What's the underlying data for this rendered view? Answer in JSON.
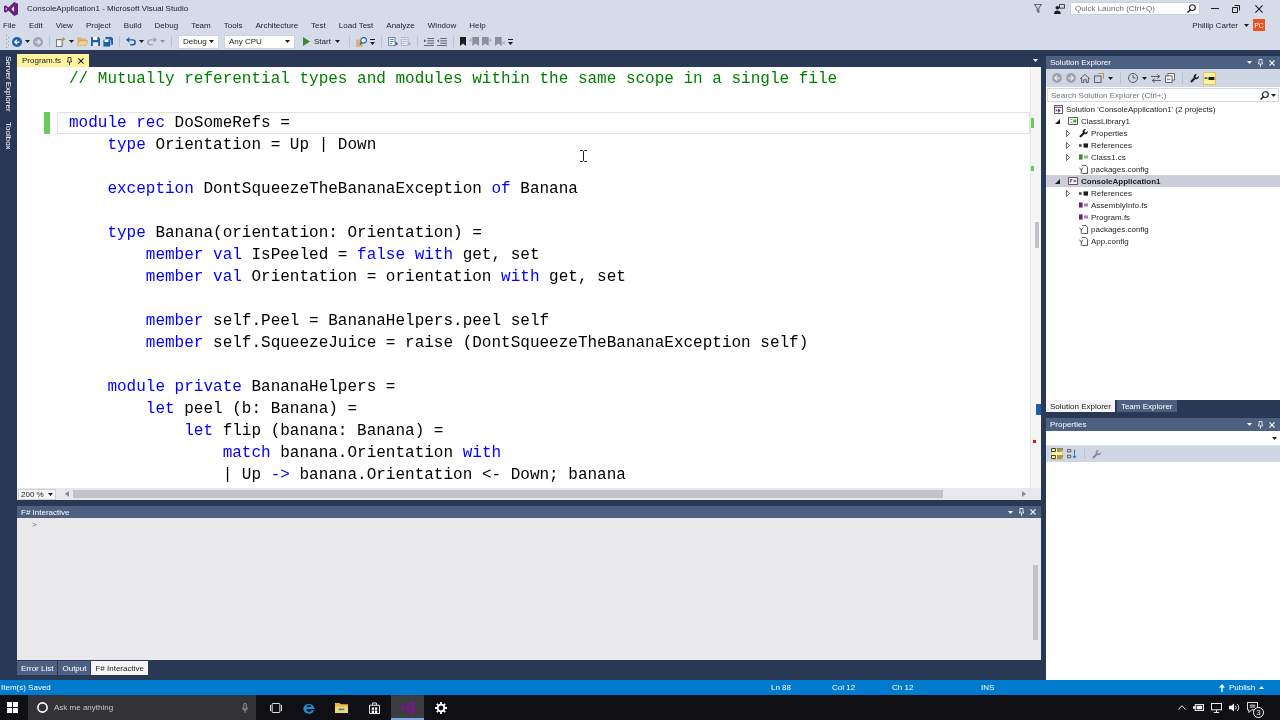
{
  "window": {
    "title": "ConsoleApplication1 - Microsoft Visual Studio",
    "quick_launch": {
      "placeholder": "Quick Launch (Ctrl+Q)"
    },
    "user": "Phillip Carter",
    "avatar": "PC"
  },
  "menu": [
    "File",
    "Edit",
    "View",
    "Project",
    "Build",
    "Debug",
    "Team",
    "Tools",
    "Architecture",
    "Test",
    "Load Test",
    "Analyze",
    "Window",
    "Help"
  ],
  "toolbar": [
    {
      "kind": "grip"
    },
    {
      "kind": "back",
      "disabled": false
    },
    {
      "kind": "caret",
      "disabled": false
    },
    {
      "kind": "forward",
      "disabled": true
    },
    {
      "kind": "separator"
    },
    {
      "kind": "new-project",
      "disabled": false
    },
    {
      "kind": "caret",
      "disabled": false
    },
    {
      "kind": "open",
      "disabled": false
    },
    {
      "kind": "save",
      "disabled": false
    },
    {
      "kind": "save-all",
      "disabled": false
    },
    {
      "kind": "separator"
    },
    {
      "kind": "undo",
      "disabled": false
    },
    {
      "kind": "caret",
      "disabled": false
    },
    {
      "kind": "redo",
      "disabled": true
    },
    {
      "kind": "caret",
      "disabled": true
    },
    {
      "kind": "separator"
    },
    {
      "kind": "combo",
      "value": "Debug"
    },
    {
      "kind": "combo",
      "value": "Any CPU"
    },
    {
      "kind": "start",
      "label": "Start"
    },
    {
      "kind": "separator"
    },
    {
      "kind": "find",
      "disabled": false
    },
    {
      "kind": "overflow"
    },
    {
      "kind": "separator"
    },
    {
      "kind": "member-list",
      "disabled": false
    },
    {
      "kind": "quick-info",
      "disabled": true
    },
    {
      "kind": "separator"
    },
    {
      "kind": "indent",
      "disabled": false
    },
    {
      "kind": "outdent",
      "disabled": false
    },
    {
      "kind": "separator"
    },
    {
      "kind": "bookmark",
      "disabled": false
    },
    {
      "kind": "bookmark-prev",
      "disabled": true
    },
    {
      "kind": "bookmark-next",
      "disabled": true
    },
    {
      "kind": "bookmark-clear",
      "disabled": true
    },
    {
      "kind": "overflow"
    }
  ],
  "side_tabs": [
    "Server Explorer",
    "Toolbox"
  ],
  "document_tabs": [
    {
      "label": "Program.fs",
      "selected": true
    }
  ],
  "editor": {
    "lines": [
      {
        "kind": "line",
        "tokens": [
          {
            "kind": "comment",
            "text": "// Mutually referential types and modules within the same scope in a single file"
          }
        ],
        "current": false,
        "changed": false
      },
      {
        "kind": "blank"
      },
      {
        "kind": "line",
        "tokens": [
          {
            "kind": "keyword",
            "text": "module rec"
          },
          {
            "kind": "plain",
            "text": " DoSomeRefs ="
          }
        ],
        "current": true,
        "changed": true,
        "children": [
          {
            "kind": "line",
            "tokens": [
              {
                "kind": "keyword",
                "text": "type"
              },
              {
                "kind": "plain",
                "text": " Orientation = Up | Down"
              }
            ],
            "current": false,
            "changed": false
          },
          {
            "kind": "blank"
          },
          {
            "kind": "line",
            "tokens": [
              {
                "kind": "keyword",
                "text": "exception"
              },
              {
                "kind": "plain",
                "text": " DontSqueezeTheBananaException "
              },
              {
                "kind": "keyword",
                "text": "of"
              },
              {
                "kind": "plain",
                "text": " Banana"
              }
            ],
            "current": false,
            "changed": false
          },
          {
            "kind": "blank"
          },
          {
            "kind": "line",
            "tokens": [
              {
                "kind": "keyword",
                "text": "type"
              },
              {
                "kind": "plain",
                "text": " Banana(orientation: Orientation) ="
              }
            ],
            "current": false,
            "changed": false,
            "children": [
              {
                "kind": "line",
                "tokens": [
                  {
                    "kind": "keyword",
                    "text": "member val"
                  },
                  {
                    "kind": "plain",
                    "text": " IsPeeled = "
                  },
                  {
                    "kind": "keyword",
                    "text": "false with"
                  },
                  {
                    "kind": "plain",
                    "text": " get, set"
                  }
                ],
                "current": false,
                "changed": false
              },
              {
                "kind": "line",
                "tokens": [
                  {
                    "kind": "keyword",
                    "text": "member val"
                  },
                  {
                    "kind": "plain",
                    "text": " Orientation = orientation "
                  },
                  {
                    "kind": "keyword",
                    "text": "with"
                  },
                  {
                    "kind": "plain",
                    "text": " get, set"
                  }
                ],
                "current": false,
                "changed": false
              },
              {
                "kind": "blank"
              },
              {
                "kind": "line",
                "tokens": [
                  {
                    "kind": "keyword",
                    "text": "member"
                  },
                  {
                    "kind": "plain",
                    "text": " self.Peel = BananaHelpers.peel self"
                  }
                ],
                "current": false,
                "changed": false
              },
              {
                "kind": "line",
                "tokens": [
                  {
                    "kind": "keyword",
                    "text": "member"
                  },
                  {
                    "kind": "plain",
                    "text": " self.SqueezeJuice = raise (DontSqueezeTheBananaException self)"
                  }
                ],
                "current": false,
                "changed": false
              }
            ]
          },
          {
            "kind": "blank"
          },
          {
            "kind": "line",
            "tokens": [
              {
                "kind": "keyword",
                "text": "module private"
              },
              {
                "kind": "plain",
                "text": " BananaHelpers ="
              }
            ],
            "current": false,
            "changed": false,
            "children": [
              {
                "kind": "line",
                "tokens": [
                  {
                    "kind": "keyword",
                    "text": "let"
                  },
                  {
                    "kind": "plain",
                    "text": " peel (b: Banana) ="
                  }
                ],
                "current": false,
                "changed": false,
                "children": [
                  {
                    "kind": "line",
                    "tokens": [
                      {
                        "kind": "keyword",
                        "text": "let"
                      },
                      {
                        "kind": "plain",
                        "text": " flip (banana: Banana) ="
                      }
                    ],
                    "current": false,
                    "changed": false,
                    "children": [
                      {
                        "kind": "line",
                        "tokens": [
                          {
                            "kind": "keyword",
                            "text": "match"
                          },
                          {
                            "kind": "plain",
                            "text": " banana.Orientation "
                          },
                          {
                            "kind": "keyword",
                            "text": "with"
                          }
                        ],
                        "current": false,
                        "changed": false
                      },
                      {
                        "kind": "line",
                        "tokens": [
                          {
                            "kind": "plain",
                            "text": "| Up "
                          },
                          {
                            "kind": "keyword",
                            "text": "->"
                          },
                          {
                            "kind": "plain",
                            "text": " banana.Orientation <- Down; banana"
                          }
                        ],
                        "current": false,
                        "changed": false
                      }
                    ]
                  }
                ]
              }
            ]
          }
        ]
      }
    ],
    "zoom": "200 %"
  },
  "fsharp_interactive": {
    "title": "F# Interactive",
    "prompt": ">"
  },
  "bottom_tabs": [
    {
      "label": "Error List",
      "selected": false
    },
    {
      "label": "Output",
      "selected": false
    },
    {
      "label": "F# Interactive",
      "selected": true
    }
  ],
  "solution_explorer": {
    "title": "Solution Explorer",
    "toolbar": [
      {
        "kind": "back",
        "disabled": true,
        "on": false
      },
      {
        "kind": "forward",
        "disabled": true,
        "on": false
      },
      {
        "kind": "home",
        "disabled": false,
        "on": false
      },
      {
        "kind": "switch-views",
        "disabled": false,
        "on": false
      },
      {
        "kind": "caret",
        "disabled": false,
        "on": false
      },
      {
        "kind": "separator"
      },
      {
        "kind": "pending-changes",
        "disabled": false,
        "on": false
      },
      {
        "kind": "caret",
        "disabled": false,
        "on": false
      },
      {
        "kind": "sync",
        "disabled": false,
        "on": false
      },
      {
        "kind": "collapse-all",
        "disabled": false,
        "on": false
      },
      {
        "kind": "separator"
      },
      {
        "kind": "properties",
        "disabled": false,
        "on": false
      },
      {
        "kind": "preview",
        "disabled": false,
        "on": true
      }
    ],
    "search": {
      "placeholder": "Search Solution Explorer (Ctrl+;)"
    },
    "tree": [
      {
        "label": "Solution 'ConsoleApplication1' (2 projects)",
        "kind": "solution",
        "selected": false,
        "startup": false,
        "children": [
          {
            "label": "ClassLibrary1",
            "kind": "project-cs",
            "expanded": true,
            "selected": false,
            "startup": false,
            "children": [
              {
                "label": "Properties",
                "kind": "properties",
                "expanded": false,
                "selected": false,
                "startup": false
              },
              {
                "label": "References",
                "kind": "references",
                "expanded": false,
                "selected": false,
                "startup": false
              },
              {
                "label": "Class1.cs",
                "kind": "file-cs",
                "expanded": false,
                "selected": false,
                "startup": false
              },
              {
                "label": "packages.config",
                "kind": "config",
                "selected": false,
                "startup": false
              }
            ]
          },
          {
            "label": "ConsoleApplication1",
            "kind": "project-fs",
            "expanded": true,
            "selected": true,
            "startup": true,
            "children": [
              {
                "label": "References",
                "kind": "references",
                "expanded": false,
                "selected": false,
                "startup": false
              },
              {
                "label": "AssemblyInfo.fs",
                "kind": "file-fs",
                "selected": false,
                "startup": false
              },
              {
                "label": "Program.fs",
                "kind": "file-fs",
                "selected": false,
                "startup": false
              },
              {
                "label": "packages.config",
                "kind": "config",
                "selected": false,
                "startup": false
              },
              {
                "label": "App.config",
                "kind": "config",
                "selected": false,
                "startup": false
              }
            ]
          }
        ]
      }
    ],
    "tabs": [
      {
        "label": "Solution Explorer",
        "selected": true
      },
      {
        "label": "Team Explorer",
        "selected": false
      }
    ]
  },
  "properties": {
    "title": "Properties",
    "toolbar": [
      {
        "kind": "categorized",
        "disabled": false,
        "on": true
      },
      {
        "kind": "alphabetical",
        "disabled": false,
        "on": false
      },
      {
        "kind": "separator"
      },
      {
        "kind": "property-pages",
        "disabled": true,
        "on": false
      }
    ]
  },
  "status_bar": {
    "message": "Item(s) Saved",
    "line": "Ln 88",
    "column": "Col 12",
    "character": "Ch 12",
    "mode": "INS",
    "publish": "Publish"
  },
  "taskbar": {
    "search": {
      "placeholder": "Ask me anything"
    },
    "apps": [
      {
        "kind": "task-view",
        "selected": false
      },
      {
        "kind": "browser",
        "selected": false
      },
      {
        "kind": "files",
        "selected": false
      },
      {
        "kind": "store",
        "selected": false
      },
      {
        "kind": "visual-studio",
        "selected": true
      },
      {
        "kind": "settings",
        "selected": false
      }
    ],
    "notification_count": "3"
  }
}
